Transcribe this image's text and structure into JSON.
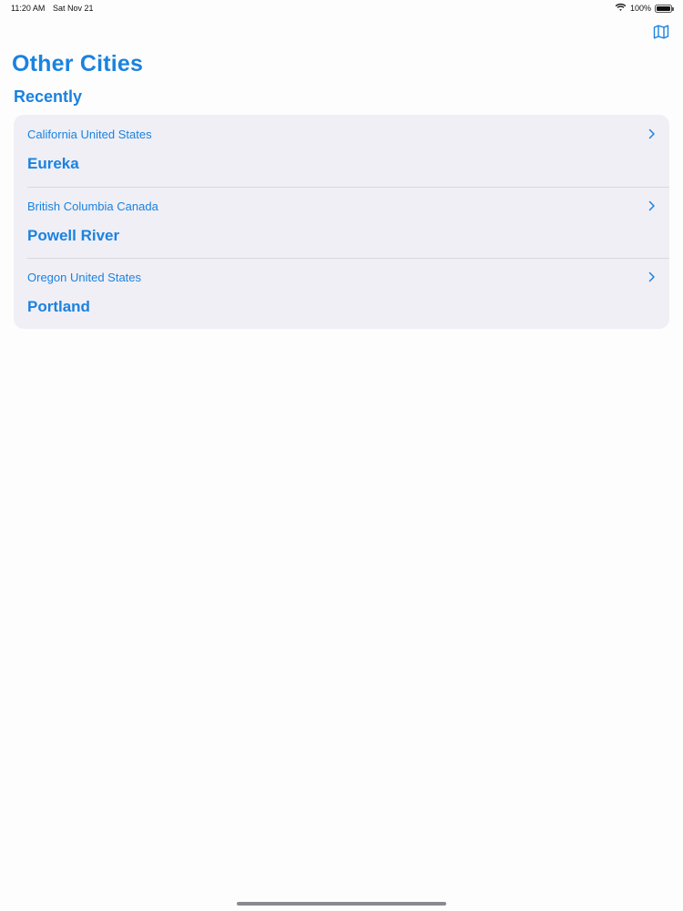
{
  "status_bar": {
    "time": "11:20 AM",
    "date": "Sat Nov 21",
    "battery_text": "100%",
    "battery_level": 1.0
  },
  "nav": {
    "map_button_icon": "map-icon",
    "title": "Other Cities"
  },
  "section": {
    "title": "Recently"
  },
  "cities": [
    {
      "region": "California United States",
      "name": "Eureka"
    },
    {
      "region": "British Columbia Canada",
      "name": "Powell River"
    },
    {
      "region": "Oregon United States",
      "name": "Portland"
    }
  ],
  "colors": {
    "accent": "#1a82e0",
    "card_background": "#f0eff5",
    "page_background": "#fdfdfd"
  }
}
